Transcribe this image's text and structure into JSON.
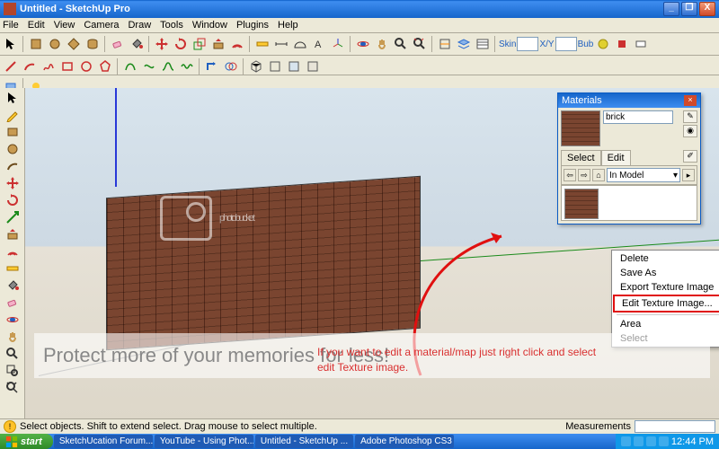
{
  "window": {
    "title": "Untitled - SketchUp Pro",
    "min": "_",
    "max": "❐",
    "close": "X"
  },
  "menu": [
    "File",
    "Edit",
    "View",
    "Camera",
    "Draw",
    "Tools",
    "Window",
    "Plugins",
    "Help"
  ],
  "toolbar_labels": {
    "skin": "Skin",
    "xy": "X/Y",
    "bub": "Bub"
  },
  "materials_panel": {
    "title": "Materials",
    "material_name": "brick",
    "tabs": {
      "select": "Select",
      "edit": "Edit"
    },
    "dropdown": "In Model"
  },
  "context_menu": {
    "items": [
      "Delete",
      "Save As",
      "Export Texture Image",
      "Edit Texture Image...",
      "",
      "Area",
      "Select"
    ],
    "highlighted_index": 3
  },
  "watermark": "photobucket",
  "protect_banner": "Protect more of your memories for less!",
  "annotation": "If you want to edit a material/map just right click and select edit Texture image.",
  "status": {
    "hint": "Select objects. Shift to extend select. Drag mouse to select multiple.",
    "measurements_label": "Measurements"
  },
  "taskbar": {
    "start": "start",
    "items": [
      "SketchUcation Forum...",
      "YouTube - Using Phot...",
      "Untitled - SketchUp ...",
      "Adobe Photoshop CS3"
    ],
    "clock": "12:44 PM"
  },
  "colors": {
    "accent_blue": "#1666cb",
    "xp_green": "#2f8a28",
    "annotation_red": "#d93030"
  }
}
